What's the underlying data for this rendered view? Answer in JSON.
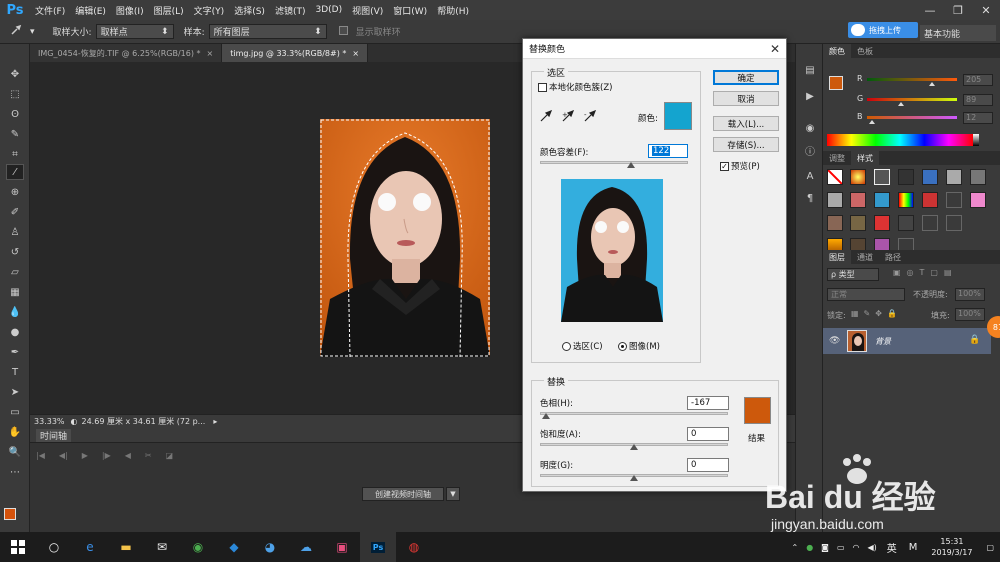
{
  "app": {
    "logo": "Ps"
  },
  "menu": [
    "文件(F)",
    "编辑(E)",
    "图像(I)",
    "图层(L)",
    "文字(Y)",
    "选择(S)",
    "滤镜(T)",
    "3D(D)",
    "视图(V)",
    "窗口(W)",
    "帮助(H)"
  ],
  "window_controls": {
    "minimize": "—",
    "restore": "❐",
    "close": "✕"
  },
  "options": {
    "sample_size_label": "取样大小:",
    "sample_size_value": "取样点",
    "sample_label": "样本:",
    "sample_value": "所有图层",
    "show_ring_label": "显示取样环",
    "baidu_upload": "拖拽上传",
    "workspace": "基本功能"
  },
  "tabs": [
    {
      "label": "IMG_0454-恢复的.TIF @ 6.25%(RGB/16) *",
      "close": "×"
    },
    {
      "label": "timg.jpg @ 33.3%(RGB/8#) *",
      "close": "×"
    }
  ],
  "status": {
    "zoom": "33.33%",
    "doc_size": "24.69 厘米 x 34.61 厘米 (72 p..."
  },
  "timeline": {
    "title": "时间轴",
    "create_button": "创建视频时间轴"
  },
  "panels": {
    "color_tabs": [
      "颜色",
      "色板"
    ],
    "channels": [
      {
        "label": "R",
        "value": "205"
      },
      {
        "label": "G",
        "value": "89"
      },
      {
        "label": "B",
        "value": "12"
      }
    ],
    "adjust_tabs": [
      "调整",
      "样式"
    ],
    "layers_tabs": [
      "图层",
      "通道",
      "路径"
    ],
    "kind_label": "ρ 类型",
    "blend_mode": "正常",
    "opacity_label": "不透明度:",
    "opacity_value": "100%",
    "lock_label": "锁定:",
    "fill_label": "填充:",
    "fill_value": "100%",
    "layer_name": "背景",
    "badge": "81"
  },
  "dialog": {
    "title": "替换颜色",
    "selection_group": "选区",
    "localized_clusters": "本地化颜色簇(Z)",
    "color_label": "颜色:",
    "fuzziness_label": "颜色容差(F):",
    "fuzziness_value": "122",
    "radio_selection": "选区(C)",
    "radio_image": "图像(M)",
    "ok": "确定",
    "cancel": "取消",
    "load": "载入(L)...",
    "save": "存储(S)...",
    "preview": "预览(P)",
    "replace_group": "替换",
    "hue_label": "色相(H):",
    "hue_value": "-167",
    "saturation_label": "饱和度(A):",
    "saturation_value": "0",
    "lightness_label": "明度(G):",
    "lightness_value": "0",
    "result_label": "结果",
    "picked_color": "#14a4cf",
    "result_color": "#cd590c"
  },
  "taskbar": {
    "time": "15:31",
    "date": "2019/3/17",
    "ime": "英",
    "ime2": "M"
  },
  "watermark": {
    "brand": "Bai du 经验",
    "url": "jingyan.baidu.com"
  }
}
